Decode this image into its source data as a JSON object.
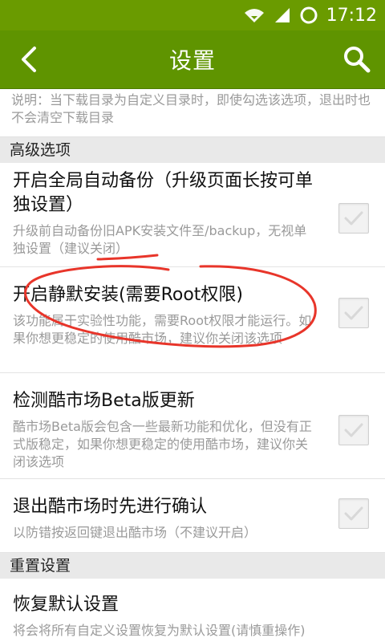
{
  "status_bar": {
    "time": "17:12"
  },
  "app_bar": {
    "title": "设置"
  },
  "top_note": "说明：当下载目录为自定义目录时，即使勾选该选项，退出时也不会清空下载目录",
  "sections": [
    {
      "title": "高级选项",
      "items": [
        {
          "title": "开启全局自动备份（升级页面长按可单独设置）",
          "desc": "升级前自动备份旧APK安装文件至/backup，无视单独设置（建议关闭）",
          "checked": false
        },
        {
          "title": "开启静默安装(需要Root权限)",
          "desc": "该功能属于实验性功能，需要Root权限才能运行。如果你想更稳定的使用酷市场，建议你关闭该选项",
          "checked": false
        },
        {
          "title": "检测酷市场Beta版更新",
          "desc": "酷市场Beta版会包含一些最新功能和优化，但没有正式版稳定，如果你想更稳定的使用酷市场，建议你关闭该选项",
          "checked": false
        },
        {
          "title": "退出酷市场时先进行确认",
          "desc": "以防错按返回键退出酷市场（不建议开启）",
          "checked": false
        }
      ]
    },
    {
      "title": "重置设置",
      "items": [
        {
          "title": "恢复默认设置",
          "desc": "将会将所有自定义设置恢复为默认设置(请慎重操作)"
        }
      ]
    }
  ],
  "colors": {
    "toolbar": "#5f9400",
    "status_bar": "#6a9b00",
    "annotation": "#e8352a"
  },
  "icons": {
    "back": "chevron-left-icon",
    "search": "search-icon",
    "wifi": "wifi-icon",
    "signal": "signal-icon",
    "loading": "loading-icon"
  }
}
